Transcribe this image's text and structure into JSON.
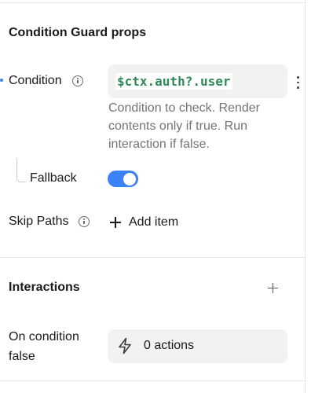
{
  "props_section": {
    "title": "Condition Guard props"
  },
  "condition": {
    "label": "Condition",
    "value": "$ctx.auth?.user",
    "help": "Condition to check. Render contents only if true. Run interaction if false."
  },
  "fallback": {
    "label": "Fallback",
    "enabled": true
  },
  "skip_paths": {
    "label": "Skip Paths",
    "add_label": "Add item"
  },
  "interactions_section": {
    "title": "Interactions",
    "on_condition_false": {
      "label_line1": "On condition",
      "label_line2": "false",
      "actions_label": "0 actions"
    }
  },
  "colors": {
    "accent": "#3b82f6",
    "code_green": "#2f8a55",
    "field_bg": "#f2f2f1",
    "help_text": "#747474",
    "divider": "#e4e4e7"
  },
  "icons": {
    "info": "info-icon",
    "more": "more-vertical-icon",
    "add": "plus-icon",
    "actions": "lightning-bolt-icon"
  }
}
